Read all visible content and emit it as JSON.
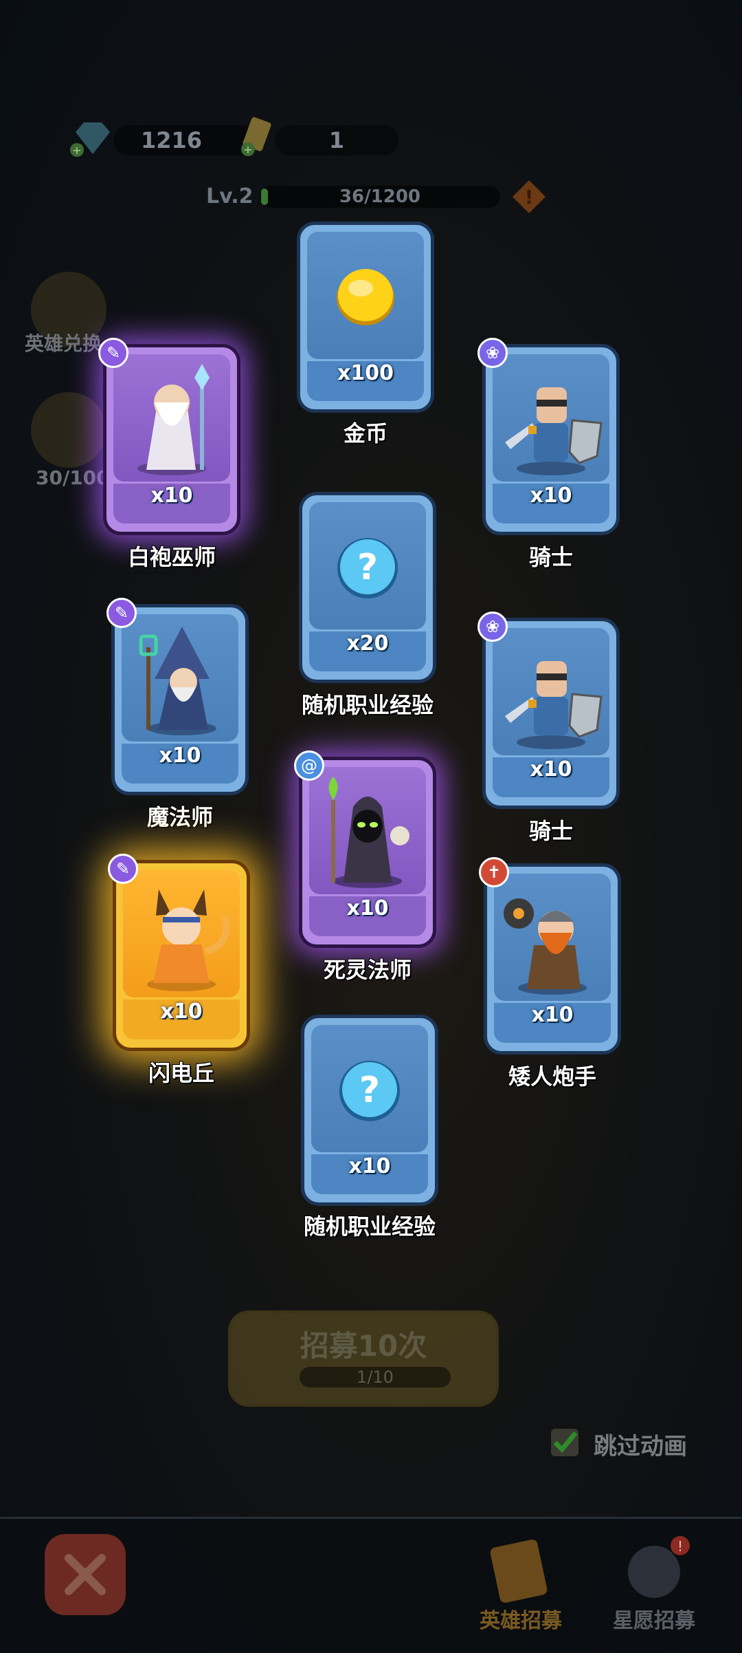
{
  "resources": {
    "gems": "1216",
    "tickets": "1"
  },
  "level": {
    "label": "Lv.2",
    "xp": "36/1200",
    "xp_fraction": 0.03
  },
  "side": {
    "exchange_label": "英雄兑换",
    "star_progress": "30/100"
  },
  "cards": [
    {
      "id": "gold",
      "qty": "x100",
      "name": "金币",
      "rarity": "common",
      "badge": null,
      "art": "gold-coin"
    },
    {
      "id": "white-wizard",
      "qty": "x10",
      "name": "白袍巫师",
      "rarity": "epic",
      "badge": "mage",
      "art": "white-wizard"
    },
    {
      "id": "knight-1",
      "qty": "x10",
      "name": "骑士",
      "rarity": "common",
      "badge": "paw",
      "art": "knight"
    },
    {
      "id": "random-xp-1",
      "qty": "x20",
      "name": "随机职业经验",
      "rarity": "common",
      "badge": null,
      "art": "question-orb"
    },
    {
      "id": "mage",
      "qty": "x10",
      "name": "魔法师",
      "rarity": "common",
      "badge": "mage",
      "art": "blue-wizard"
    },
    {
      "id": "knight-2",
      "qty": "x10",
      "name": "骑士",
      "rarity": "common",
      "badge": "paw",
      "art": "knight"
    },
    {
      "id": "necromancer",
      "qty": "x10",
      "name": "死灵法师",
      "rarity": "epic",
      "badge": "swirl",
      "art": "necromancer"
    },
    {
      "id": "lightning-qiu",
      "qty": "x10",
      "name": "闪电丘",
      "rarity": "legendary",
      "badge": "mage",
      "art": "fox-girl"
    },
    {
      "id": "dwarf-gunner",
      "qty": "x10",
      "name": "矮人炮手",
      "rarity": "common",
      "badge": "fire",
      "art": "dwarf"
    },
    {
      "id": "random-xp-2",
      "qty": "x10",
      "name": "随机职业经验",
      "rarity": "common",
      "badge": null,
      "art": "question-orb"
    }
  ],
  "recruit": {
    "label": "招募10次",
    "progress": "1/10"
  },
  "skip": {
    "label": "跳过动画",
    "checked": true
  },
  "nav": {
    "hero_recruit": "英雄招募",
    "wish_recruit": "星愿招募"
  },
  "colors": {
    "common_card": "#7cb1e2",
    "epic_card": "#b48ae6",
    "legendary_card": "#f7c437"
  }
}
